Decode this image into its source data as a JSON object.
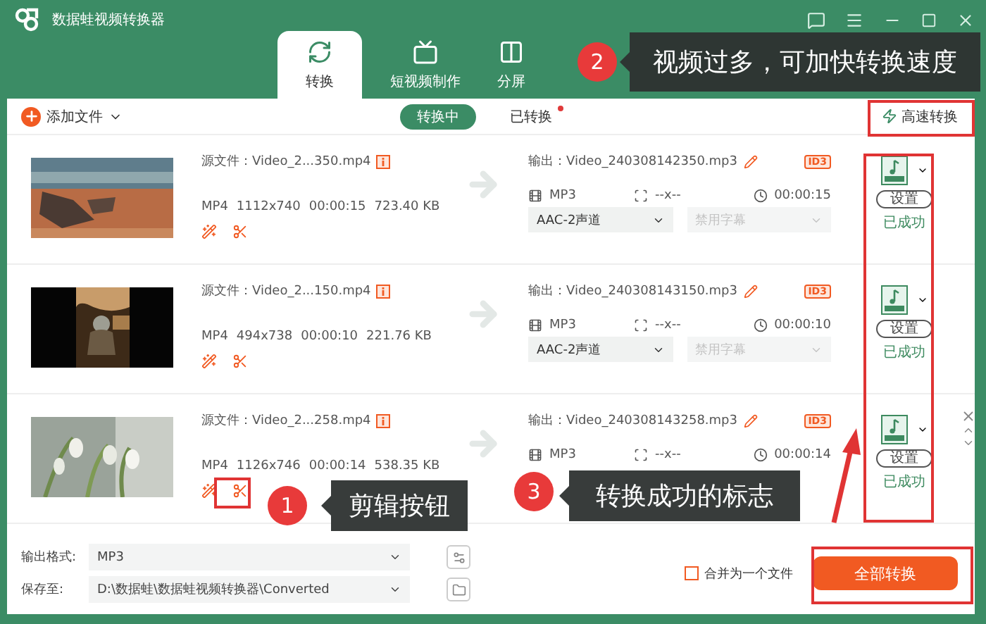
{
  "window": {
    "title": "数据蛙视频转换器"
  },
  "tabs": [
    {
      "label": "转换",
      "kind": "convert",
      "selected": true
    },
    {
      "label": "短视频制作",
      "kind": "tv",
      "selected": false
    },
    {
      "label": "分屏",
      "kind": "split",
      "selected": false
    }
  ],
  "toolbar": {
    "add_button": "添加文件",
    "segments": [
      {
        "label": "转换中",
        "selected": true,
        "dot": false
      },
      {
        "label": "已转换",
        "selected": false,
        "dot": true
      }
    ],
    "speed_button": "高速转换"
  },
  "files": [
    {
      "source": "源文件：Video_2...350.mp4",
      "format": "MP4",
      "resolution": "1112x740",
      "duration": "00:00:15",
      "size": "723.40 KB",
      "output": "输出：Video_240308142350.mp3",
      "id3": "ID3",
      "out_format": "MP3",
      "out_resolution": "--x--",
      "out_duration": "00:00:15",
      "audio": "AAC-2声道",
      "subtitle": {
        "label": "禁用字幕",
        "disabled": true
      },
      "settings_button": "设置",
      "status": "已成功"
    },
    {
      "source": "源文件：Video_2...150.mp4",
      "format": "MP4",
      "resolution": "494x738",
      "duration": "00:00:10",
      "size": "221.76 KB",
      "output": "输出：Video_240308143150.mp3",
      "id3": "ID3",
      "out_format": "MP3",
      "out_resolution": "--x--",
      "out_duration": "00:00:10",
      "audio": "AAC-2声道",
      "subtitle": {
        "label": "禁用字幕",
        "disabled": true
      },
      "settings_button": "设置",
      "status": "已成功"
    },
    {
      "source": "源文件：Video_2...258.mp4",
      "format": "MP4",
      "resolution": "1126x746",
      "duration": "00:00:14",
      "size": "538.35 KB",
      "output": "输出：Video_240308143258.mp3",
      "id3": "ID3",
      "out_format": "MP3",
      "out_resolution": "--x--",
      "out_duration": "00:00:14",
      "settings_button": "设置",
      "status": "已成功"
    }
  ],
  "bottom": {
    "format_label": "输出格式:",
    "format": "MP3",
    "save_label": "保存至:",
    "path": "D:\\数据蛙\\数据蛙视频转换器\\Converted",
    "merge": {
      "label": "合并为一个文件",
      "checked": false
    },
    "convert_all": "全部转换"
  },
  "annotations": [
    {
      "number": "1",
      "text": "剪辑按钮"
    },
    {
      "number": "2",
      "text": "视频过多，可加快转换速度"
    },
    {
      "number": "3",
      "text": "转换成功的标志"
    }
  ]
}
